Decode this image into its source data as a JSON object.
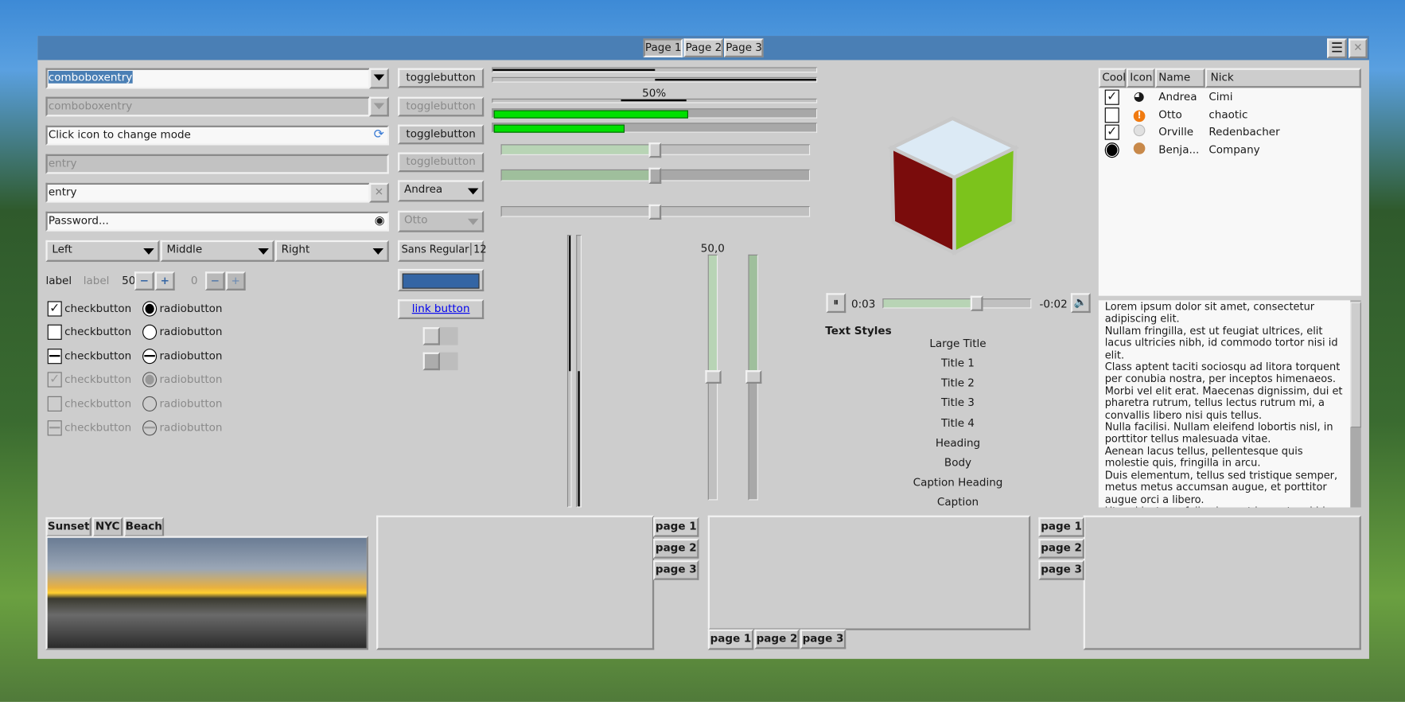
{
  "window": {
    "pages": [
      "Page 1",
      "Page 2",
      "Page 3"
    ],
    "active_page": 0,
    "menu_icon": "hamburger-icon",
    "close_icon": "close-icon",
    "titlebar_color": "#4a7fb5"
  },
  "left": {
    "combo1": "comboboxentry",
    "combo2": "comboboxentry",
    "entry_mode": "Click icon to change mode",
    "entry_disabled": "entry",
    "entry_clear": "entry",
    "password": "Password...",
    "combos": [
      "Left",
      "Middle",
      "Right"
    ],
    "label1": "label",
    "label2": "label",
    "spin1": "50",
    "spin2": "0",
    "checks": [
      {
        "label": "checkbutton",
        "state": "checked"
      },
      {
        "label": "checkbutton",
        "state": "unchecked"
      },
      {
        "label": "checkbutton",
        "state": "mixed"
      },
      {
        "label": "checkbutton",
        "state": "checked",
        "disabled": true
      },
      {
        "label": "checkbutton",
        "state": "unchecked",
        "disabled": true
      },
      {
        "label": "checkbutton",
        "state": "mixed",
        "disabled": true
      }
    ],
    "radios": [
      {
        "label": "radiobutton",
        "state": "checked"
      },
      {
        "label": "radiobutton",
        "state": "unchecked"
      },
      {
        "label": "radiobutton",
        "state": "mixed"
      },
      {
        "label": "radiobutton",
        "state": "checked",
        "disabled": true
      },
      {
        "label": "radiobutton",
        "state": "unchecked",
        "disabled": true
      },
      {
        "label": "radiobutton",
        "state": "mixed",
        "disabled": true
      }
    ]
  },
  "buttons": {
    "toggles": [
      "togglebutton",
      "togglebutton",
      "togglebutton",
      "togglebutton"
    ],
    "combo_andrea": "Andrea",
    "combo_otto": "Otto",
    "font_name": "Sans Regular",
    "font_size": "12",
    "color": "#3465a4",
    "link": "link button",
    "switches": [
      false,
      false
    ]
  },
  "progress": {
    "label": "50%",
    "value_percent": 50,
    "green1_percent": 60,
    "green2_percent": 40,
    "scale_value": "50,0",
    "scale_percent": 50,
    "accent": "#00e000"
  },
  "media": {
    "elapsed": "0:03",
    "remaining": "-0:02",
    "position_percent": 60
  },
  "text_styles": {
    "heading": "Text Styles",
    "items": [
      "Large Title",
      "Title 1",
      "Title 2",
      "Title 3",
      "Title 4",
      "Heading",
      "Body",
      "Caption Heading",
      "Caption"
    ]
  },
  "tree": {
    "columns": [
      "Cool",
      "Icon",
      "Name",
      "Nick"
    ],
    "rows": [
      {
        "cool": "checked",
        "icon": "pacman-icon",
        "name": "Andrea",
        "nick": "Cimi"
      },
      {
        "cool": "unchecked",
        "icon": "warning-icon",
        "name": "Otto",
        "nick": "chaotic"
      },
      {
        "cool": "checked",
        "icon": "moon-icon",
        "name": "Orville",
        "nick": "Redenbacher"
      },
      {
        "cool": "radio",
        "icon": "monkey-icon",
        "name": "Benja...",
        "nick": "Company"
      }
    ]
  },
  "textview": [
    "Lorem ipsum dolor sit amet, consectetur adipiscing elit.",
    "Nullam fringilla, est ut feugiat ultrices, elit lacus ultricies nibh, id commodo tortor nisi id elit.",
    "Class aptent taciti sociosqu ad litora torquent per conubia nostra, per inceptos himenaeos.",
    "Morbi vel elit erat. Maecenas dignissim, dui et pharetra rutrum, tellus lectus rutrum mi, a convallis libero nisi quis tellus.",
    "Nulla facilisi. Nullam eleifend lobortis nisl, in porttitor tellus malesuada vitae.",
    "Aenean lacus tellus, pellentesque quis molestie quis, fringilla in arcu.",
    "Duis elementum, tellus sed tristique semper, metus metus accumsan augue, et porttitor augue orci a libero.",
    "Ut sed justo ac felis placerat laoreet sed id sem."
  ],
  "notebooks": {
    "images": [
      "Sunset",
      "NYC",
      "Beach"
    ],
    "pages": [
      "page 1",
      "page 2",
      "page 3"
    ]
  }
}
